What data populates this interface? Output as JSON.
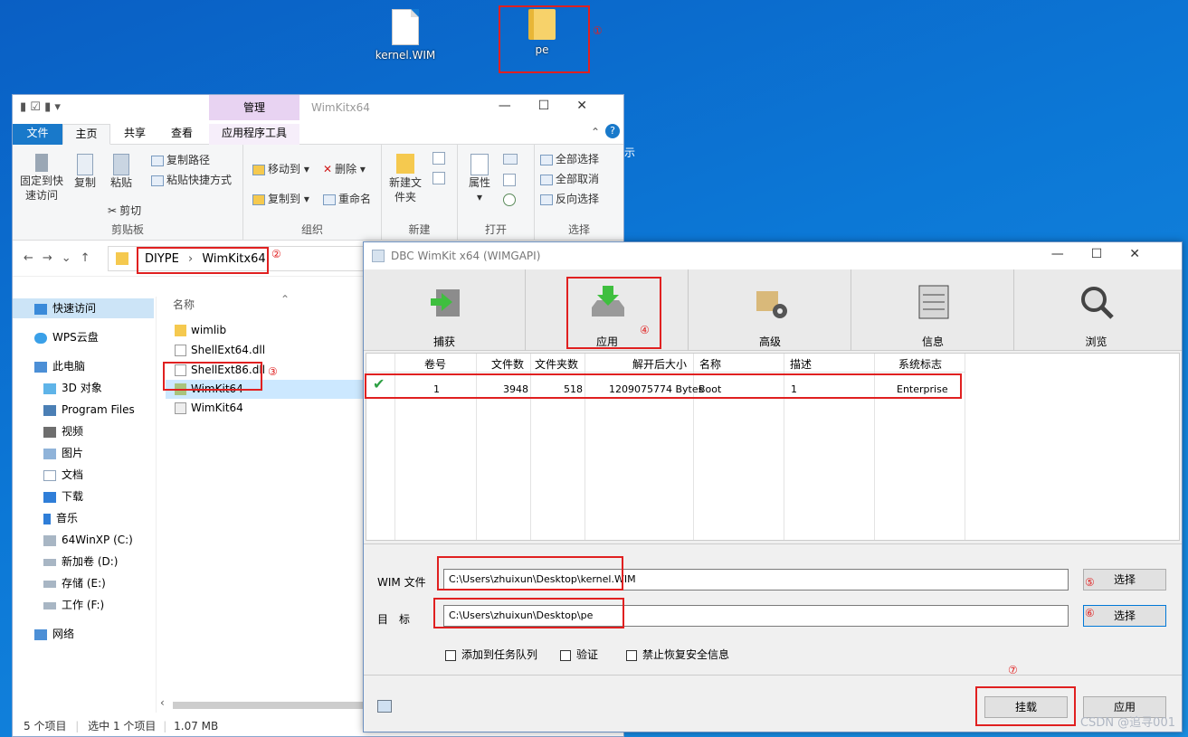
{
  "desktop": {
    "icons": [
      {
        "label": "kernel.WIM"
      },
      {
        "label": "pe"
      }
    ],
    "annotations": [
      "①",
      "②",
      "③",
      "④",
      "⑤",
      "⑥",
      "⑦"
    ],
    "behind_text": "示"
  },
  "explorer": {
    "ribbon_context_tab": "管理",
    "title": "WimKitx64",
    "tabs": [
      "文件",
      "主页",
      "共享",
      "查看",
      "应用程序工具"
    ],
    "groups": {
      "clipboard": {
        "name": "剪贴板",
        "pin": "固定到快速访问",
        "copy": "复制",
        "paste": "粘贴",
        "copy_path": "复制路径",
        "paste_shortcut": "粘贴快捷方式",
        "cut": "剪切"
      },
      "organize": {
        "name": "组织",
        "move_to": "移动到",
        "delete": "删除",
        "copy_to": "复制到",
        "rename": "重命名"
      },
      "new": {
        "name": "新建",
        "new_folder": "新建文件夹"
      },
      "open": {
        "name": "打开",
        "properties": "属性"
      },
      "select": {
        "name": "选择",
        "select_all": "全部选择",
        "select_none": "全部取消",
        "invert": "反向选择"
      }
    },
    "breadcrumb": [
      "DIYPE",
      "WimKitx64"
    ],
    "sidebar": [
      "快速访问",
      "WPS云盘",
      "此电脑",
      "3D 对象",
      "Program Files",
      "视频",
      "图片",
      "文档",
      "下载",
      "音乐",
      "64WinXP (C:)",
      "新加卷 (D:)",
      "存储 (E:)",
      "工作 (F:)",
      "网络"
    ],
    "column_name": "名称",
    "files": [
      "wimlib",
      "ShellExt64.dll",
      "ShellExt86.dll",
      "WimKit64",
      "WimKit64"
    ],
    "status": {
      "count": "5 个项目",
      "selected": "选中 1 个项目",
      "size": "1.07 MB"
    }
  },
  "wimkit": {
    "title": "DBC WimKit x64 (WIMGAPI)",
    "toolbar": [
      "捕获",
      "应用",
      "高级",
      "信息",
      "浏览"
    ],
    "columns": [
      "卷号",
      "文件数",
      "文件夹数",
      "解开后大小",
      "名称",
      "描述",
      "系统标志"
    ],
    "rows": [
      {
        "volume": "1",
        "files": "3948",
        "folders": "518",
        "size": "1209075774 Bytes",
        "name": "Boot",
        "desc": "1",
        "flag": "Enterprise"
      }
    ],
    "wim_label": "WIM 文件",
    "wim_path": "C:\\Users\\zhuixun\\Desktop\\kernel.WIM",
    "target_label": "目　标",
    "target_path": "C:\\Users\\zhuixun\\Desktop\\pe",
    "browse_label": "选择",
    "options": [
      "添加到任务队列",
      "验证",
      "禁止恢复安全信息"
    ],
    "mount_button": "挂载",
    "apply_button": "应用"
  },
  "watermark": "CSDN @追寻001"
}
